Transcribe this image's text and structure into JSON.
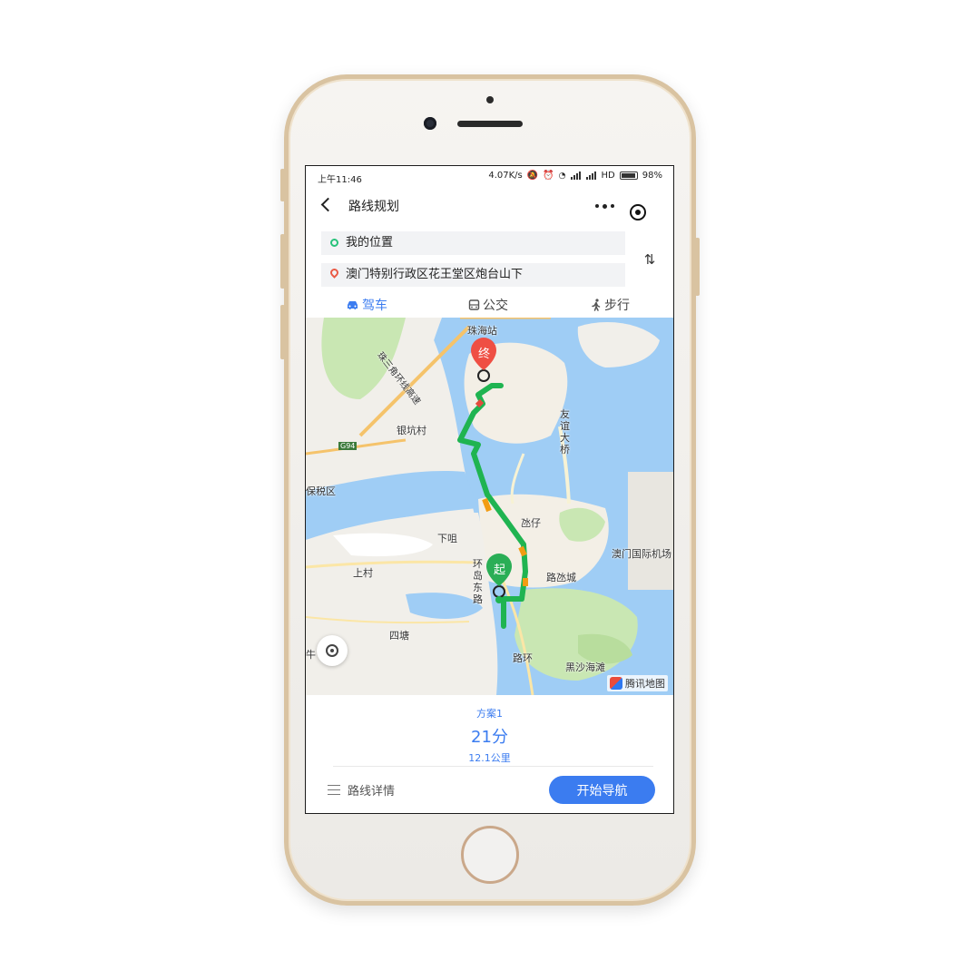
{
  "status_bar": {
    "time": "上午11:46",
    "speed": "4.07K/s",
    "network": "HD",
    "battery": "98%"
  },
  "nav": {
    "title": "路线规划",
    "more_icon": "more-dots-icon",
    "target_icon": "target-icon"
  },
  "route": {
    "origin": "我的位置",
    "destination": "澳门特别行政区花王堂区炮台山下",
    "swap_icon": "swap-icon",
    "swap_glyph": "⇅"
  },
  "modes": [
    {
      "label": "驾车",
      "icon": "car-icon",
      "active": true
    },
    {
      "label": "公交",
      "icon": "bus-icon",
      "active": false
    },
    {
      "label": "步行",
      "icon": "walk-icon",
      "active": false
    }
  ],
  "map": {
    "labels": {
      "zhuhai_station": "珠海站",
      "yinkeng": "银坑村",
      "friendship_bridge": "友谊大桥",
      "bonded": "保税区",
      "taipa": "氹仔",
      "xiaju": "下咀",
      "airport": "澳门国际机场",
      "shangcun": "上村",
      "cotai": "路氹城",
      "ring_road": "环岛东路",
      "sitang": "四塘",
      "luhuan": "路环",
      "hac_sa": "黑沙海滩",
      "niu": "牛",
      "expressway": "珠三角环线高速",
      "g94": "G94"
    },
    "end_marker": "终",
    "start_marker": "起",
    "locate_icon": "locate-icon",
    "provider": "腾讯地图",
    "colors": {
      "water": "#9fcdf5",
      "land": "#f1efea",
      "green": "#c9e7b3",
      "route_smooth": "#1fb451",
      "route_slow": "#f29c13",
      "route_jam": "#e44b3c",
      "end_marker": "#ef4f44",
      "start_marker": "#2aae56"
    }
  },
  "plan": {
    "name": "方案1",
    "time": "21分",
    "distance": "12.1公里"
  },
  "footer": {
    "detail_label": "路线详情",
    "start_button": "开始导航"
  },
  "accent": "#3b7cf0"
}
